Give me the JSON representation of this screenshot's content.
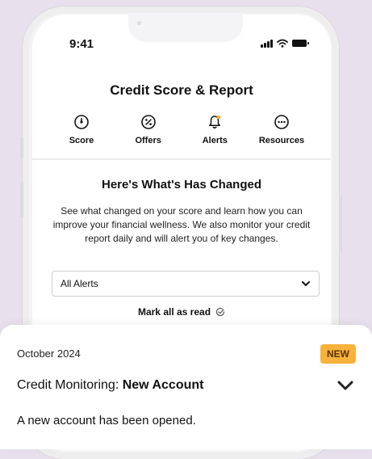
{
  "status_bar": {
    "time": "9:41"
  },
  "header": {
    "title": "Credit Score & Report"
  },
  "tabs": [
    {
      "label": "Score",
      "icon": "speedometer-icon"
    },
    {
      "label": "Offers",
      "icon": "percent-icon"
    },
    {
      "label": "Alerts",
      "icon": "bell-icon"
    },
    {
      "label": "Resources",
      "icon": "more-icon"
    }
  ],
  "changes": {
    "title": "Here's What's Has Changed",
    "description": "See what changed on your score and learn how you can improve your financial wellness. We also monitor your credit report daily and will alert you of key changes."
  },
  "filter": {
    "selected": "All Alerts"
  },
  "mark_all_read": {
    "label": "Mark all as read"
  },
  "alert_card": {
    "date": "October 2024",
    "badge": "NEW",
    "title_prefix": "Credit Monitoring: ",
    "title_bold": "New Account",
    "description": "A new account has been opened."
  },
  "colors": {
    "badge": "#f7b23b",
    "alert_dot": "#f7b23b",
    "background": "#e8e0ec"
  }
}
